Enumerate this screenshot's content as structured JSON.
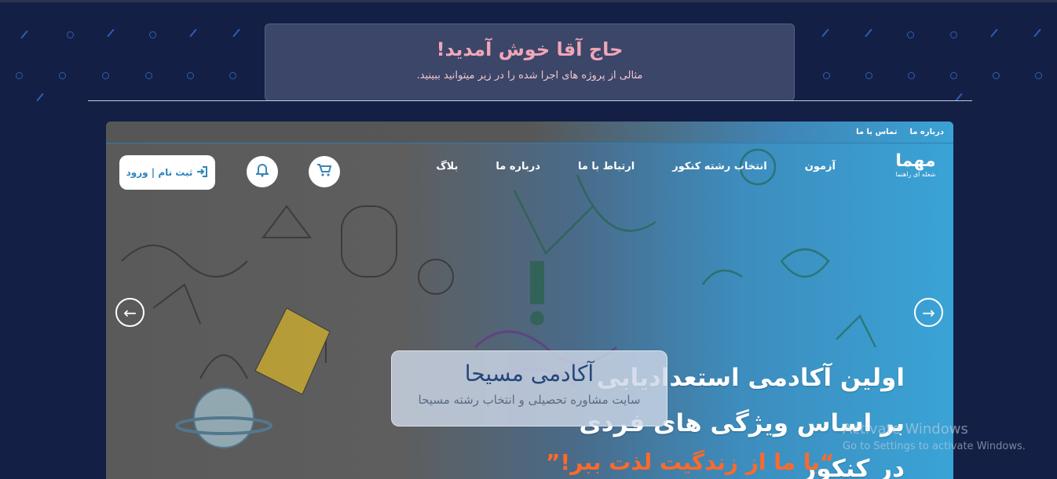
{
  "header": {
    "title": "حاج آقا خوش آمدید!",
    "subtitle": "مثالی از پروژه های اجرا شده را در زیر میتوانید ببینید."
  },
  "preview": {
    "topbar": {
      "links": [
        "درباره ما",
        "تماس با ما"
      ]
    },
    "logo": {
      "mark": "مهما",
      "tagline": "شعله ای راهنما"
    },
    "nav": {
      "items": [
        "آزمون",
        "انتخاب رشته کنکور",
        "ارتباط با ما",
        "درباره ما",
        "بلاگ"
      ]
    },
    "auth_label": "ثبت نام | ورود",
    "icons": {
      "cart": "cart-icon",
      "bell": "bell-icon",
      "login": "login-icon"
    },
    "hero": {
      "line1": "اولین آکادمی استعدادیابی",
      "line2": "بر اساس ویژگی های فردی در کنکور",
      "slogan": "“با ما از زندگیت لذت ببر!”"
    },
    "caption": {
      "title": "آکادمی مسیحا",
      "subtitle": "سایت مشاوره تحصیلی و انتخاب رشته مسیحا"
    }
  },
  "watermark": {
    "line1": "Activate Windows",
    "line2": "Go to Settings to activate Windows."
  },
  "colors": {
    "background": "#141f45",
    "accent": "#3aa3d6",
    "title_pink": "#f0a6b8",
    "slogan_orange": "#ff6a2a"
  }
}
